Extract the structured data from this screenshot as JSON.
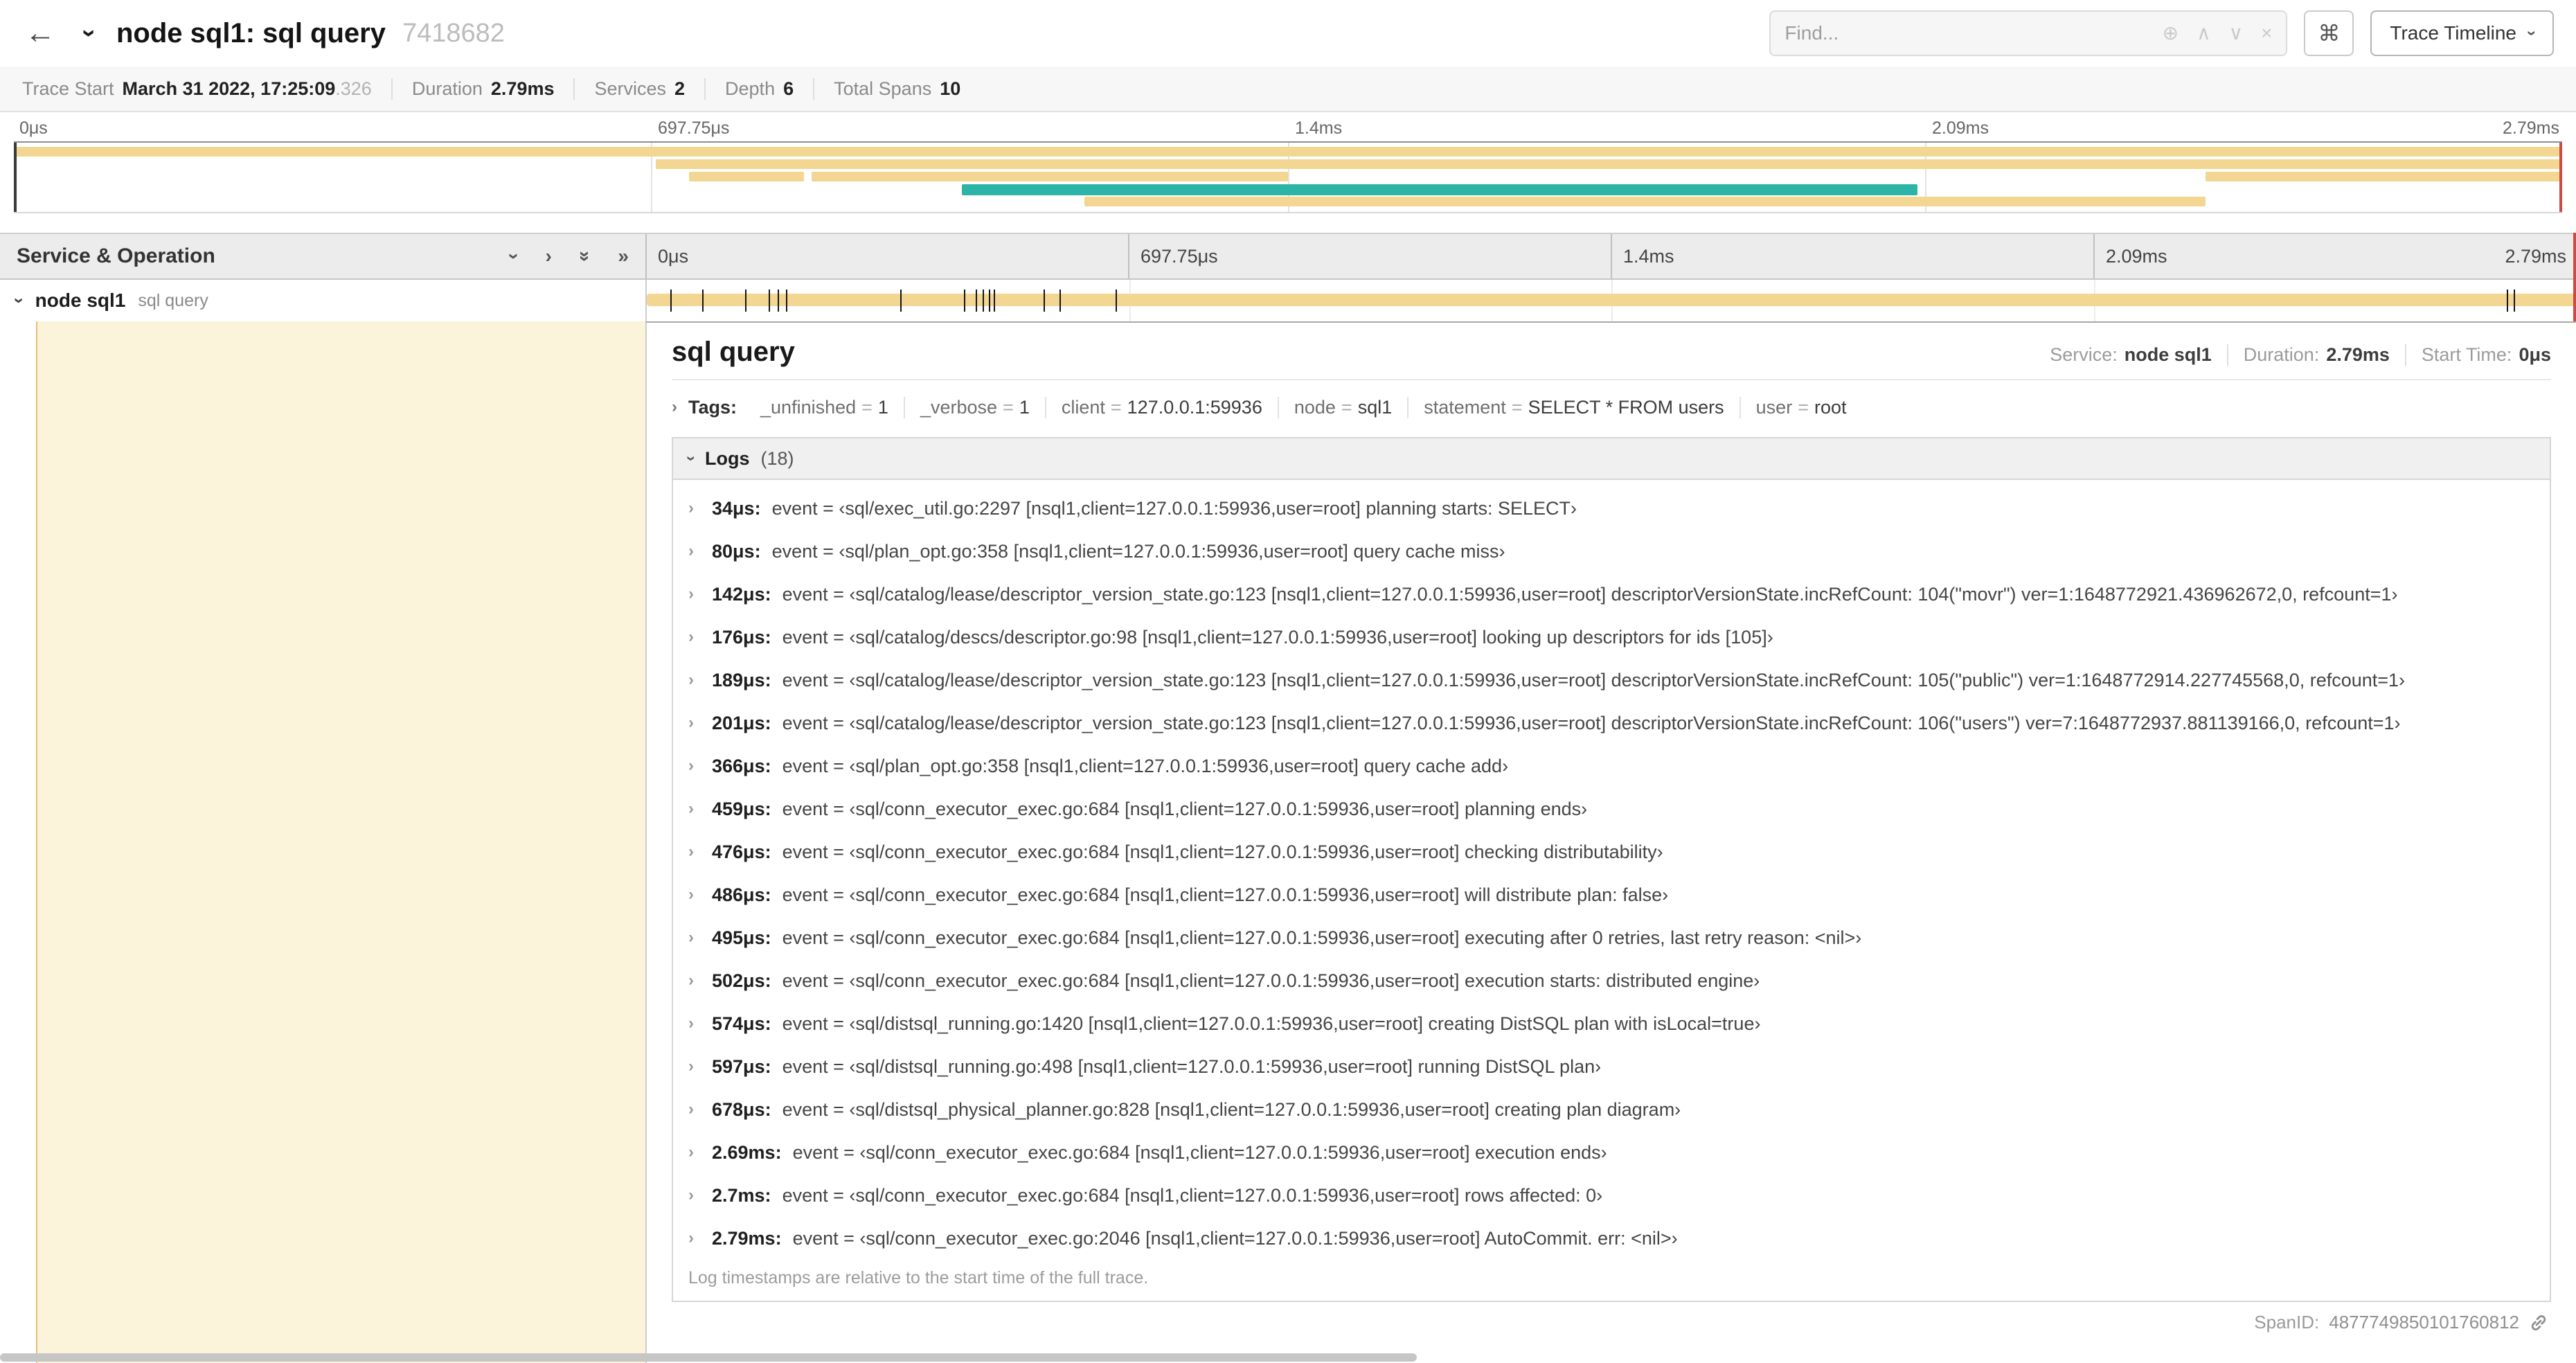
{
  "colors": {
    "span_tan": "#f2d691",
    "span_teal": "#2cb5a6",
    "selected_row_tint": "#fbf3da",
    "accent_edge": "#dfc176",
    "scrubber_red": "#cf4a44"
  },
  "icons": {
    "back": "←",
    "chevron": "›",
    "double_chevron": "»",
    "target": "⊕",
    "up": "∧",
    "down": "∨",
    "close": "×",
    "command": "⌘"
  },
  "header": {
    "title": "node sql1: sql query",
    "trace_id": "7418682",
    "find_placeholder": "Find...",
    "view_selector": "Trace Timeline"
  },
  "trace_stats": {
    "items": [
      {
        "label": "Trace Start",
        "value": "March 31 2022, 17:25:09",
        "suffix": ".326"
      },
      {
        "label": "Duration",
        "value": "2.79ms",
        "suffix": ""
      },
      {
        "label": "Services",
        "value": "2",
        "suffix": ""
      },
      {
        "label": "Depth",
        "value": "6",
        "suffix": ""
      },
      {
        "label": "Total Spans",
        "value": "10",
        "suffix": ""
      }
    ]
  },
  "time_ticks": [
    "0μs",
    "697.75μs",
    "1.4ms",
    "2.09ms",
    "2.79ms"
  ],
  "minimap": {
    "spans": [
      {
        "row": 0,
        "start_pct": 0,
        "end_pct": 100,
        "color": "span_tan"
      },
      {
        "row": 1,
        "start_pct": 25.2,
        "end_pct": 100,
        "color": "span_tan"
      },
      {
        "row": 2,
        "start_pct": 26.5,
        "end_pct": 31,
        "color": "span_tan"
      },
      {
        "row": 2,
        "start_pct": 31.3,
        "end_pct": 50,
        "color": "span_tan"
      },
      {
        "row": 2,
        "start_pct": 86,
        "end_pct": 100,
        "color": "span_tan"
      },
      {
        "row": 3,
        "start_pct": 37.2,
        "end_pct": 74.7,
        "color": "span_teal",
        "height": 8
      },
      {
        "row": 4,
        "start_pct": 42,
        "end_pct": 86,
        "color": "span_tan"
      }
    ]
  },
  "timeline": {
    "left_header": "Service & Operation",
    "row": {
      "service": "node sql1",
      "operation": "sql query",
      "tick_positions_pct": [
        1.22,
        2.87,
        5.09,
        6.31,
        6.77,
        7.2,
        13.12,
        16.45,
        17.06,
        17.42,
        17.74,
        17.99,
        20.57,
        21.4,
        24.3,
        96.42,
        96.77,
        100
      ]
    }
  },
  "detail": {
    "title": "sql query",
    "meta": [
      {
        "label": "Service:",
        "value": "node sql1"
      },
      {
        "label": "Duration:",
        "value": "2.79ms"
      },
      {
        "label": "Start Time:",
        "value": "0μs"
      }
    ],
    "tags_label": "Tags:",
    "tag_eq": "=",
    "tags": [
      {
        "key": "_unfinished",
        "value": "1"
      },
      {
        "key": "_verbose",
        "value": "1"
      },
      {
        "key": "client",
        "value": "127.0.0.1:59936"
      },
      {
        "key": "node",
        "value": "sql1"
      },
      {
        "key": "statement",
        "value": "SELECT * FROM users"
      },
      {
        "key": "user",
        "value": "root"
      }
    ],
    "logs_label": "Logs",
    "logs_count": "(18)",
    "logs": [
      {
        "time": "34μs:",
        "text": "event = ‹sql/exec_util.go:2297 [nsql1,client=127.0.0.1:59936,user=root] planning starts: SELECT›"
      },
      {
        "time": "80μs:",
        "text": "event = ‹sql/plan_opt.go:358 [nsql1,client=127.0.0.1:59936,user=root] query cache miss›"
      },
      {
        "time": "142μs:",
        "text": "event = ‹sql/catalog/lease/descriptor_version_state.go:123 [nsql1,client=127.0.0.1:59936,user=root] descriptorVersionState.incRefCount: 104(\"movr\") ver=1:1648772921.436962672,0, refcount=1›"
      },
      {
        "time": "176μs:",
        "text": "event = ‹sql/catalog/descs/descriptor.go:98 [nsql1,client=127.0.0.1:59936,user=root] looking up descriptors for ids [105]›"
      },
      {
        "time": "189μs:",
        "text": "event = ‹sql/catalog/lease/descriptor_version_state.go:123 [nsql1,client=127.0.0.1:59936,user=root] descriptorVersionState.incRefCount: 105(\"public\") ver=1:1648772914.227745568,0, refcount=1›"
      },
      {
        "time": "201μs:",
        "text": "event = ‹sql/catalog/lease/descriptor_version_state.go:123 [nsql1,client=127.0.0.1:59936,user=root] descriptorVersionState.incRefCount: 106(\"users\") ver=7:1648772937.881139166,0, refcount=1›"
      },
      {
        "time": "366μs:",
        "text": "event = ‹sql/plan_opt.go:358 [nsql1,client=127.0.0.1:59936,user=root] query cache add›"
      },
      {
        "time": "459μs:",
        "text": "event = ‹sql/conn_executor_exec.go:684 [nsql1,client=127.0.0.1:59936,user=root] planning ends›"
      },
      {
        "time": "476μs:",
        "text": "event = ‹sql/conn_executor_exec.go:684 [nsql1,client=127.0.0.1:59936,user=root] checking distributability›"
      },
      {
        "time": "486μs:",
        "text": "event = ‹sql/conn_executor_exec.go:684 [nsql1,client=127.0.0.1:59936,user=root] will distribute plan: false›"
      },
      {
        "time": "495μs:",
        "text": "event = ‹sql/conn_executor_exec.go:684 [nsql1,client=127.0.0.1:59936,user=root] executing after 0 retries, last retry reason: <nil>›"
      },
      {
        "time": "502μs:",
        "text": "event = ‹sql/conn_executor_exec.go:684 [nsql1,client=127.0.0.1:59936,user=root] execution starts: distributed engine›"
      },
      {
        "time": "574μs:",
        "text": "event = ‹sql/distsql_running.go:1420 [nsql1,client=127.0.0.1:59936,user=root] creating DistSQL plan with isLocal=true›"
      },
      {
        "time": "597μs:",
        "text": "event = ‹sql/distsql_running.go:498 [nsql1,client=127.0.0.1:59936,user=root] running DistSQL plan›"
      },
      {
        "time": "678μs:",
        "text": "event = ‹sql/distsql_physical_planner.go:828 [nsql1,client=127.0.0.1:59936,user=root] creating plan diagram›"
      },
      {
        "time": "2.69ms:",
        "text": "event = ‹sql/conn_executor_exec.go:684 [nsql1,client=127.0.0.1:59936,user=root] execution ends›"
      },
      {
        "time": "2.7ms:",
        "text": "event = ‹sql/conn_executor_exec.go:684 [nsql1,client=127.0.0.1:59936,user=root] rows affected: 0›"
      },
      {
        "time": "2.79ms:",
        "text": "event = ‹sql/conn_executor_exec.go:2046 [nsql1,client=127.0.0.1:59936,user=root] AutoCommit. err: <nil>›"
      }
    ],
    "logs_footer": "Log timestamps are relative to the start time of the full trace.",
    "span_id_label": "SpanID:",
    "span_id": "4877749850101760812"
  }
}
